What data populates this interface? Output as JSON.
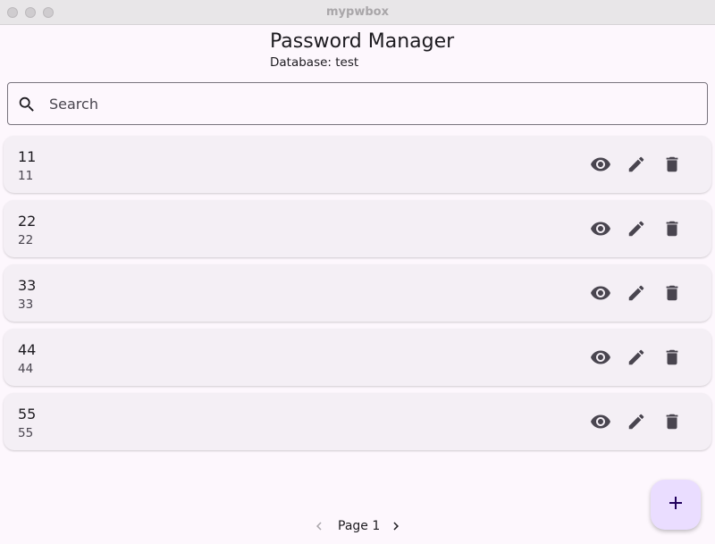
{
  "window": {
    "title": "mypwbox"
  },
  "header": {
    "title": "Password Manager",
    "database_label": "Database: test"
  },
  "search": {
    "placeholder": "Search",
    "value": ""
  },
  "entries": [
    {
      "title": "11",
      "subtitle": "11"
    },
    {
      "title": "22",
      "subtitle": "22"
    },
    {
      "title": "33",
      "subtitle": "33"
    },
    {
      "title": "44",
      "subtitle": "44"
    },
    {
      "title": "55",
      "subtitle": "55"
    }
  ],
  "pagination": {
    "label": "Page 1"
  },
  "icons": {
    "search": "search-icon",
    "view": "eye-icon",
    "edit": "pencil-icon",
    "delete": "trash-icon",
    "add": "plus-icon",
    "prev": "chevron-left-icon",
    "next": "chevron-right-icon"
  },
  "colors": {
    "background": "#fdf7fd",
    "card": "#f4eff5",
    "fab": "#eaddff",
    "icon": "#49454f"
  }
}
